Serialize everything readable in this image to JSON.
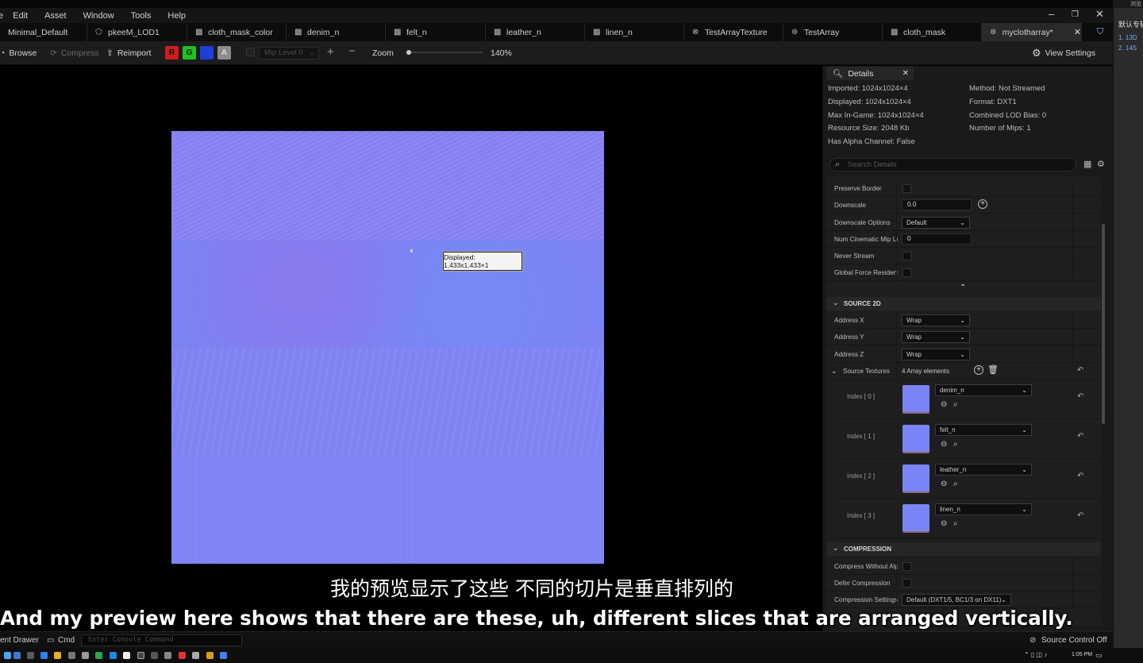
{
  "menu": [
    "e",
    "Edit",
    "Asset",
    "Window",
    "Tools",
    "Help"
  ],
  "tabs": [
    {
      "label": "Minimal_Default"
    },
    {
      "label": "pkeeM_LOD1"
    },
    {
      "label": "cloth_mask_color"
    },
    {
      "label": "denim_n"
    },
    {
      "label": "felt_n"
    },
    {
      "label": "leather_n"
    },
    {
      "label": "linen_n"
    },
    {
      "label": "TestArrayTexture"
    },
    {
      "label": "TestArray"
    },
    {
      "label": "cloth_mask"
    },
    {
      "label": "myclotharray*"
    }
  ],
  "toolbar": {
    "browse": "Browse",
    "compress": "Compress",
    "reimport": "Reimport",
    "channels": [
      "R",
      "G",
      "B",
      "A"
    ],
    "mip_level": "Mip Level 0",
    "zoom_label": "Zoom",
    "zoom_value": "140%",
    "zoom_fraction": 0.03,
    "view_settings": "View Settings"
  },
  "viewport": {
    "tooltip": "Displayed: 1,433x1,433×1"
  },
  "details": {
    "tab": "Details",
    "info_left": [
      "Imported: 1024x1024×4",
      "Displayed: 1024x1024×4",
      "Max In-Game: 1024x1024×4",
      "Resource Size: 2048 Kb",
      "Has Alpha Channel: False"
    ],
    "info_right": [
      "Method: Not Streamed",
      "Format: DXT1",
      "Combined LOD Bias: 0",
      "Number of Mips: 1"
    ],
    "search_placeholder": "Search Details",
    "props": {
      "preserve_border": "Preserve Border",
      "downscale": "Downscale",
      "downscale_value": "0.0",
      "downscale_options": "Downscale Options",
      "downscale_options_value": "Default",
      "num_cinematic": "Num Cinematic Mip Le",
      "num_cinematic_value": "0",
      "never_stream": "Never Stream",
      "global_force": "Global Force Resident"
    },
    "source2d": {
      "title": "SOURCE 2D",
      "address_x": "Address X",
      "address_y": "Address Y",
      "address_z": "Address Z",
      "wrap": "Wrap",
      "source_textures": "Source Textures",
      "array_count": "4 Array elements",
      "elements": [
        {
          "index": "Index [ 0 ]",
          "value": "denim_n"
        },
        {
          "index": "Index [ 1 ]",
          "value": "felt_n"
        },
        {
          "index": "Index [ 2 ]",
          "value": "leather_n"
        },
        {
          "index": "Index [ 3 ]",
          "value": "linen_n"
        }
      ]
    },
    "compression": {
      "title": "COMPRESSION",
      "without_alpha": "Compress Without Alp",
      "defer": "Defer Compression",
      "settings": "Compression Settings",
      "settings_value": "Default (DXT1/5, BC1/3 on DX11)"
    }
  },
  "status": {
    "content_drawer": "ent Drawer",
    "cmd": "Cmd",
    "console_placeholder": "Enter Console Command",
    "source_control": "Source Control Off",
    "clock": "1:05 PM"
  },
  "side": {
    "title": "默认专辑",
    "top": "浏览",
    "lines": [
      "1. 13D",
      "2. 14S"
    ]
  },
  "subtitles": {
    "cn": "我的预览显示了这些 不同的切片是垂直排列的",
    "en": "And my preview here shows that there are these, uh, different slices that are arranged vertically."
  },
  "colors": {
    "normal_map": "#7b84f7",
    "channel_r": "#d01c1c",
    "channel_g": "#1ec21e",
    "channel_b": "#1f3fd8",
    "channel_a": "#8c8c8c"
  }
}
